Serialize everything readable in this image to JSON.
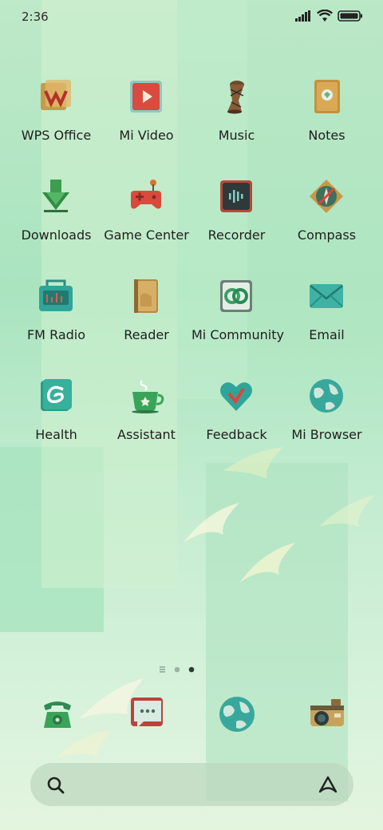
{
  "status_bar": {
    "time": "2:36"
  },
  "apps": [
    {
      "label": "WPS Office",
      "icon": "wps-office-icon"
    },
    {
      "label": "Mi Video",
      "icon": "mi-video-icon"
    },
    {
      "label": "Music",
      "icon": "music-drum-icon"
    },
    {
      "label": "Notes",
      "icon": "notes-icon"
    },
    {
      "label": "Downloads",
      "icon": "downloads-icon"
    },
    {
      "label": "Game Center",
      "icon": "game-center-icon"
    },
    {
      "label": "Recorder",
      "icon": "recorder-icon"
    },
    {
      "label": "Compass",
      "icon": "compass-icon"
    },
    {
      "label": "FM Radio",
      "icon": "fm-radio-icon"
    },
    {
      "label": "Reader",
      "icon": "reader-icon"
    },
    {
      "label": "Mi Community",
      "icon": "mi-community-icon"
    },
    {
      "label": "Email",
      "icon": "email-icon"
    },
    {
      "label": "Health",
      "icon": "health-icon"
    },
    {
      "label": "Assistant",
      "icon": "assistant-cup-icon"
    },
    {
      "label": "Feedback",
      "icon": "feedback-heart-icon"
    },
    {
      "label": "Mi Browser",
      "icon": "mi-browser-icon"
    }
  ],
  "page_indicator": {
    "pages": 3,
    "current": 3
  },
  "dock": [
    {
      "icon": "phone-icon"
    },
    {
      "icon": "messages-icon"
    },
    {
      "icon": "browser-icon"
    },
    {
      "icon": "camera-icon"
    }
  ],
  "colors": {
    "label_text": "#1f1f1f",
    "accent_green": "#6cc48a"
  }
}
